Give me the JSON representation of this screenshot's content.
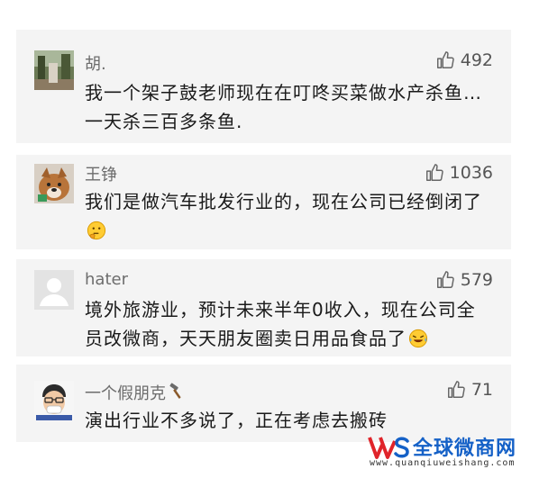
{
  "comments": [
    {
      "username": "胡.",
      "likes": "492",
      "avatar": "photo-avatar",
      "text": "我一个架子鼓老师现在在叮咚买菜做水产杀鱼…一天杀三百多条鱼."
    },
    {
      "username": "王铮",
      "likes": "1036",
      "avatar": "dog-avatar",
      "text": "我们是做汽车批发行业的，现在公司已经倒闭了",
      "emoji": "thinking-emoji"
    },
    {
      "username": "hater",
      "likes": "579",
      "avatar": "default-user-avatar",
      "text": "境外旅游业，预计未来半年0收入，现在公司全员改微商，天天朋友圈卖日用品食品了",
      "emoji": "laugh-cry-emoji"
    },
    {
      "username": "一个假朋克",
      "username_icon": "hammer-icon",
      "likes": "71",
      "avatar": "cartoon-avatar",
      "text": "演出行业不多说了，正在考虑去搬砖"
    }
  ],
  "watermark": {
    "title": "全球微商网",
    "url": "www.quanqiuweishang.com",
    "logo_text": "WS"
  },
  "colors": {
    "card_bg": "#f4f4f4",
    "username": "#6d6d6d",
    "watermark_blue": "#1561c7",
    "watermark_red": "#e0242a"
  }
}
